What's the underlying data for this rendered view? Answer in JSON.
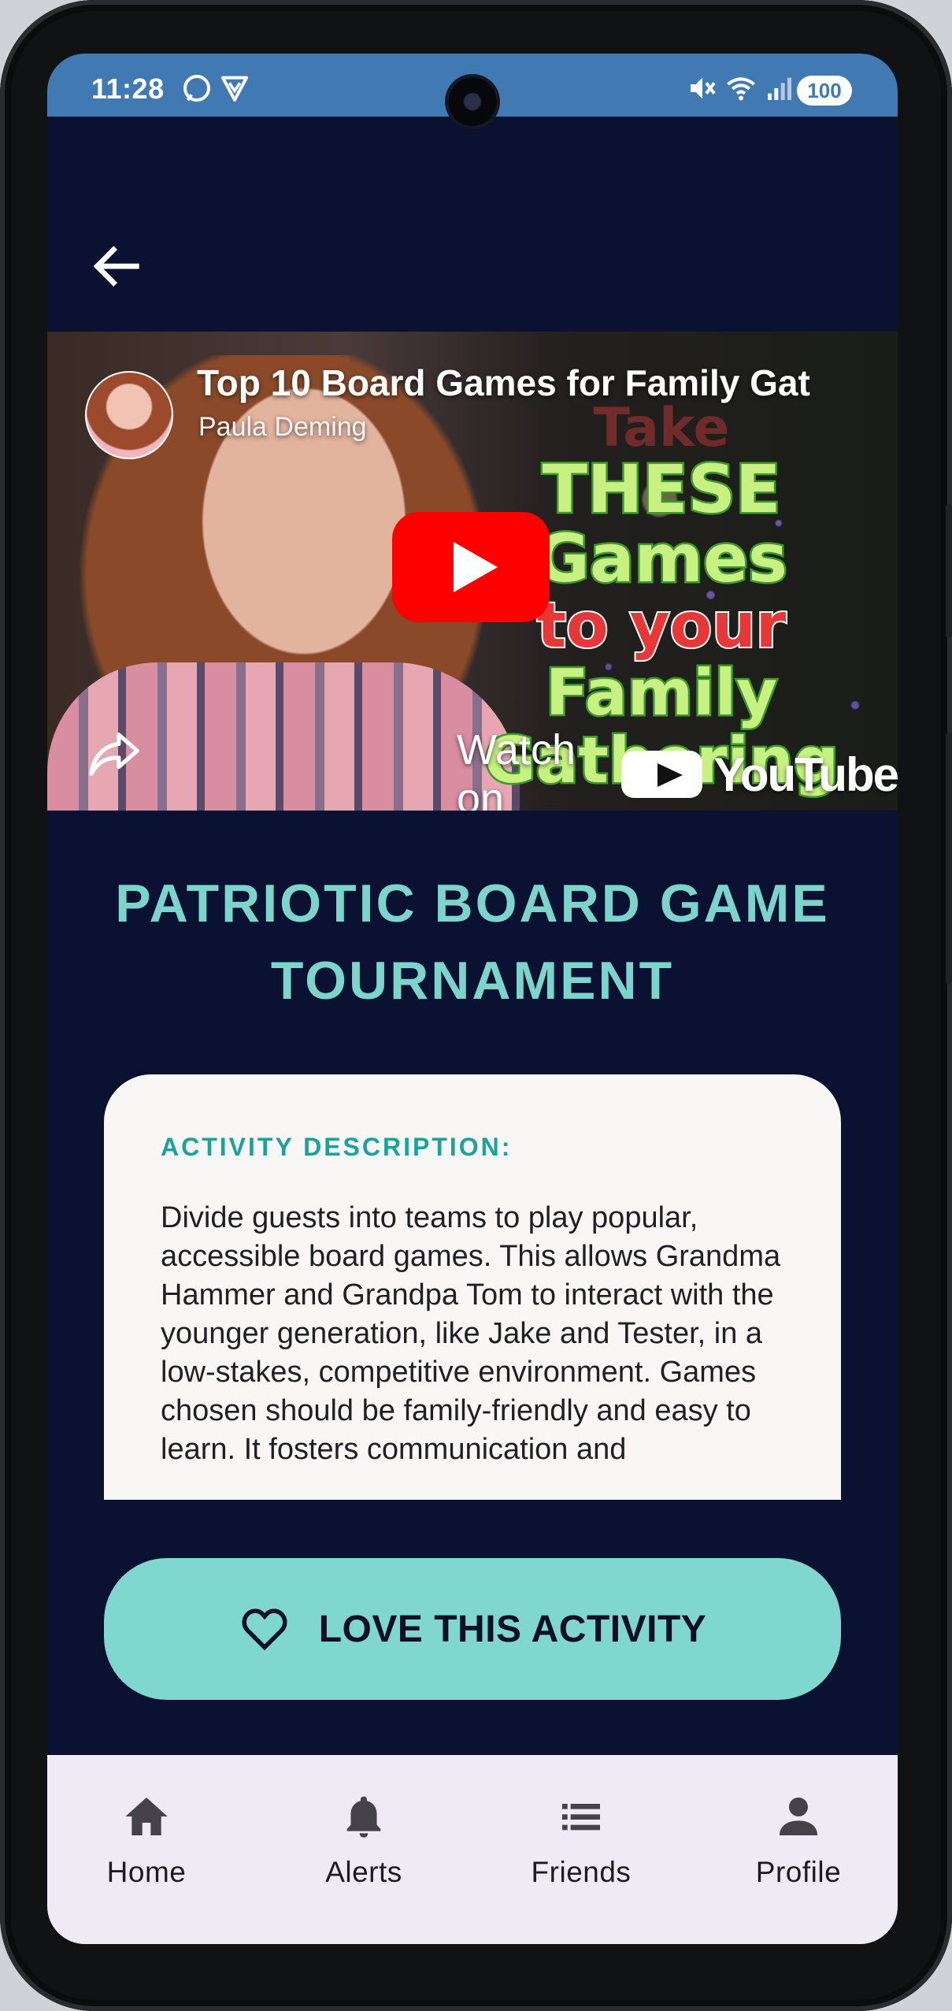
{
  "status_bar": {
    "time": "11:28",
    "battery": "100"
  },
  "video": {
    "title": "Top 10 Board Games for Family Gat",
    "channel": "Paula Deming",
    "thumbnail_text": [
      "Take",
      "THESE Games",
      "to your",
      "Family",
      "Gathering"
    ],
    "watch_on": "Watch on",
    "youtube_wordmark": "YouTube"
  },
  "activity": {
    "title": "PATRIOTIC BOARD GAME TOURNAMENT",
    "description_label": "ACTIVITY DESCRIPTION:",
    "description": "Divide guests into teams to play popular, accessible board games. This allows Grandma Hammer and Grandpa Tom to interact with the younger generation, like Jake and Tester, in a low-stakes, competitive environment. Games chosen should be family-friendly and easy to learn. It fosters communication and"
  },
  "love_button": {
    "label": "LOVE THIS ACTIVITY",
    "icon": "heart-outline-icon"
  },
  "bottom_nav": {
    "items": [
      {
        "label": "Home",
        "icon": "home-icon"
      },
      {
        "label": "Alerts",
        "icon": "bell-icon"
      },
      {
        "label": "Friends",
        "icon": "list-icon"
      },
      {
        "label": "Profile",
        "icon": "person-icon"
      }
    ]
  },
  "colors": {
    "status_bar": "#4179b3",
    "background": "#0b1130",
    "accent": "#7dd4cc",
    "card": "#f8f7f5",
    "nav_bar": "#f0eaf4",
    "youtube_red": "#ff0000"
  }
}
